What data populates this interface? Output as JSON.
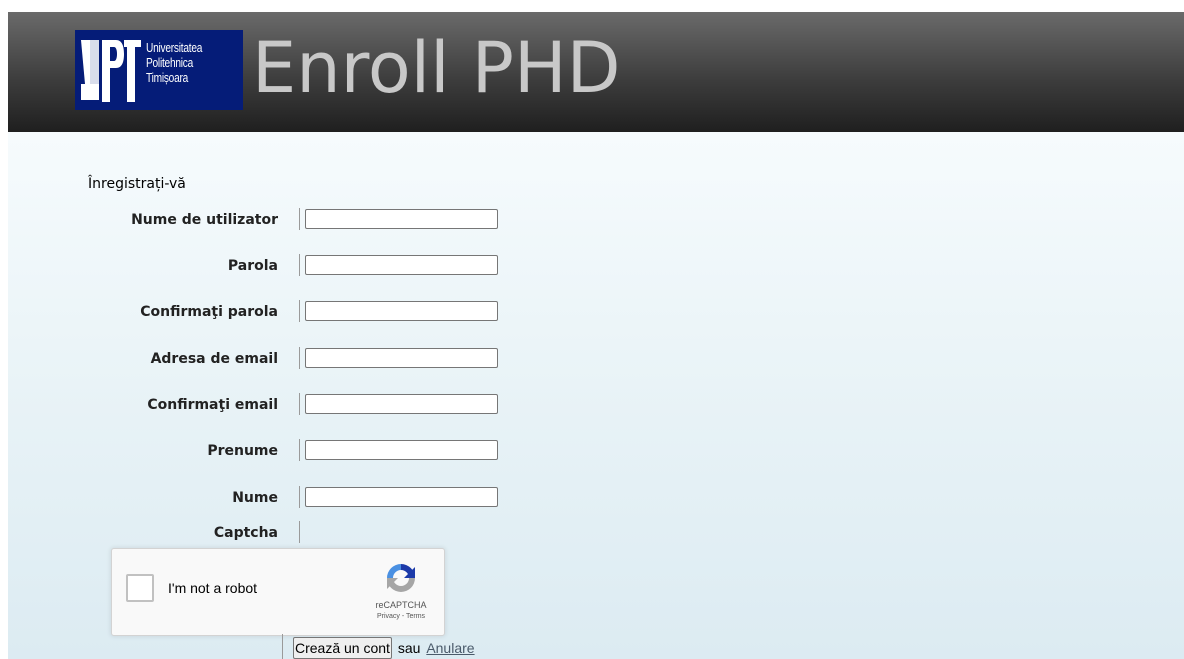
{
  "header": {
    "logo": {
      "mark": "UPT",
      "lines": [
        "Universitatea",
        "Politehnica",
        "Timișoara"
      ]
    },
    "app_title": "Enroll PHD"
  },
  "form": {
    "title": "Înregistrați-vă",
    "fields": [
      {
        "label": "Nume de utilizator",
        "value": "",
        "type": "text"
      },
      {
        "label": "Parola",
        "value": "",
        "type": "password"
      },
      {
        "label": "Confirmaţi parola",
        "value": "",
        "type": "password"
      },
      {
        "label": "Adresa de email",
        "value": "",
        "type": "text"
      },
      {
        "label": "Confirmaţi email",
        "value": "",
        "type": "text"
      },
      {
        "label": "Prenume",
        "value": "",
        "type": "text"
      },
      {
        "label": "Nume",
        "value": "",
        "type": "text"
      }
    ],
    "captcha_label": "Captcha"
  },
  "recaptcha": {
    "label": "I'm not a robot",
    "brand": "reCAPTCHA",
    "links": "Privacy - Terms",
    "checked": false
  },
  "actions": {
    "create_label": "Crează un cont",
    "or_text": "sau",
    "cancel_label": "Anulare"
  },
  "colors": {
    "header_dark": "#1f1f1f",
    "logo_blue": "#051c78",
    "title_gray": "#c8c8c8",
    "content_bg": "#e7f2f6"
  }
}
